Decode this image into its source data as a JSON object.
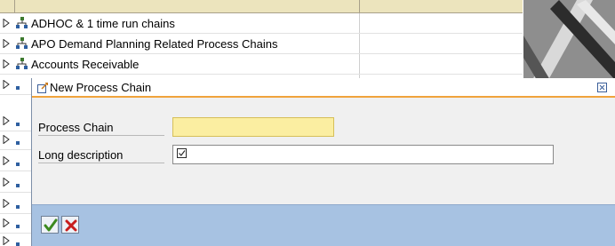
{
  "tree": {
    "items": [
      {
        "label": "ADHOC & 1 time run chains"
      },
      {
        "label": "APO Demand Planning Related Process Chains"
      },
      {
        "label": "Accounts Receivable"
      }
    ],
    "icons": {
      "toggle": "collapsed-triangle-icon",
      "chain": "process-chain-icon"
    }
  },
  "dialog": {
    "title": "New Process Chain",
    "title_icon": "new-document-icon",
    "close_icon": "close-icon",
    "fields": {
      "process_chain": {
        "label": "Process Chain",
        "value": ""
      },
      "long_description": {
        "label": "Long description",
        "value": "",
        "icon": "checkbox-checked-icon"
      }
    },
    "buttons": {
      "ok": {
        "icon": "green-checkmark-icon"
      },
      "cancel": {
        "icon": "red-x-icon"
      }
    }
  },
  "colors": {
    "required_field": "#fbeea1",
    "footer": "#a7c2e2",
    "title_accent": "#f0a33c",
    "header": "#ece4bd"
  }
}
